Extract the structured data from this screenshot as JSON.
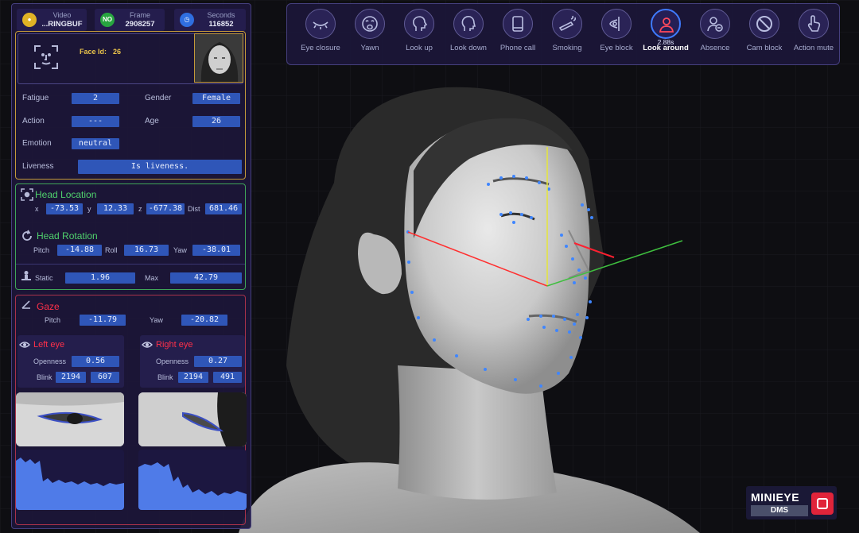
{
  "topbar": {
    "video": {
      "label": "Video",
      "value": "...RINGBUF"
    },
    "frame": {
      "label": "Frame",
      "value": "2908257",
      "icon_text": "NO"
    },
    "seconds": {
      "label": "Seconds",
      "value": "116852"
    }
  },
  "face": {
    "id_label": "Face Id:",
    "id_value": "26"
  },
  "attributes": {
    "fatigue": {
      "label": "Fatigue",
      "value": "2"
    },
    "gender": {
      "label": "Gender",
      "value": "Female"
    },
    "action": {
      "label": "Action",
      "value": "---"
    },
    "age": {
      "label": "Age",
      "value": "26"
    },
    "emotion": {
      "label": "Emotion",
      "value": "neutral"
    },
    "liveness": {
      "label": "Liveness",
      "value": "Is liveness."
    }
  },
  "head_location": {
    "title": "Head Location",
    "x": {
      "label": "x",
      "value": "-73.53"
    },
    "y": {
      "label": "y",
      "value": "12.33"
    },
    "z": {
      "label": "z",
      "value": "-677.38"
    },
    "dist": {
      "label": "Dist",
      "value": "681.46"
    }
  },
  "head_rotation": {
    "title": "Head Rotation",
    "pitch": {
      "label": "Pitch",
      "value": "-14.88"
    },
    "roll": {
      "label": "Roll",
      "value": "16.73"
    },
    "yaw": {
      "label": "Yaw",
      "value": "-38.01"
    }
  },
  "static_row": {
    "static": {
      "label": "Static",
      "value": "1.96"
    },
    "max": {
      "label": "Max",
      "value": "42.79"
    }
  },
  "gaze": {
    "title": "Gaze",
    "pitch": {
      "label": "Pitch",
      "value": "-11.79"
    },
    "yaw": {
      "label": "Yaw",
      "value": "-20.82"
    }
  },
  "left_eye": {
    "title": "Left eye",
    "openness": {
      "label": "Openness",
      "value": "0.56"
    },
    "blink": {
      "label": "Blink",
      "value1": "2194",
      "value2": "607"
    }
  },
  "right_eye": {
    "title": "Right eye",
    "openness": {
      "label": "Openness",
      "value": "0.27"
    },
    "blink": {
      "label": "Blink",
      "value1": "2194",
      "value2": "491"
    }
  },
  "toolbar": {
    "items": [
      {
        "label": "Eye closure",
        "icon": "eye-closed-icon"
      },
      {
        "label": "Yawn",
        "icon": "yawn-icon"
      },
      {
        "label": "Look up",
        "icon": "head-up-icon"
      },
      {
        "label": "Look down",
        "icon": "head-down-icon"
      },
      {
        "label": "Phone call",
        "icon": "phone-icon"
      },
      {
        "label": "Smoking",
        "icon": "cigarette-icon"
      },
      {
        "label": "Eye block",
        "icon": "eye-block-icon"
      },
      {
        "label": "Look around",
        "icon": "person-icon",
        "time": "2.88s",
        "active": true
      },
      {
        "label": "Absence",
        "icon": "absence-icon"
      },
      {
        "label": "Cam block",
        "icon": "no-sign-icon"
      },
      {
        "label": "Action mute",
        "icon": "hand-icon"
      }
    ]
  },
  "brand": {
    "name": "MINIEYE",
    "product": "DMS"
  },
  "colors": {
    "panel": "#1c163a",
    "accent_blue": "#2f56b8",
    "green": "#4fd06c",
    "red": "#ff3049",
    "active_ring": "#3f7bff",
    "logo_red": "#e0243a"
  }
}
